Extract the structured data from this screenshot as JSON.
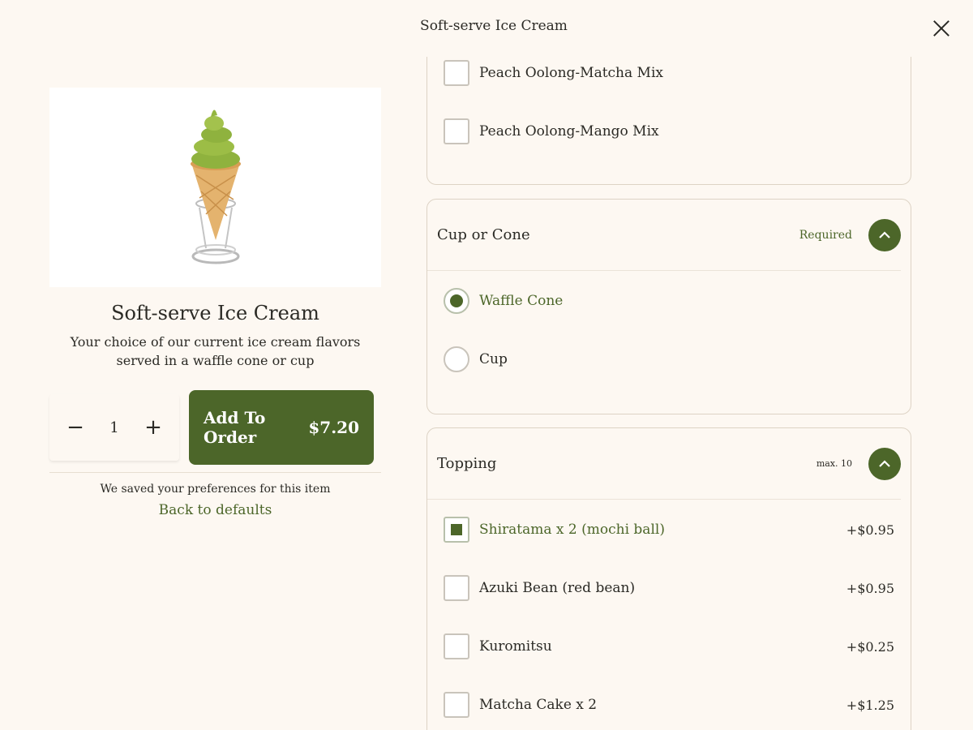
{
  "header": {
    "title": "Soft-serve Ice Cream"
  },
  "product": {
    "name": "Soft-serve Ice Cream",
    "description": "Your choice of our current ice cream flavors served in a waffle cone or cup"
  },
  "order": {
    "quantity": "1",
    "minus": "−",
    "plus": "+",
    "add_label": "Add To Order",
    "price": "$7.20"
  },
  "preferences": {
    "saved_text": "We saved your preferences for this item",
    "defaults_link": "Back to defaults"
  },
  "flavor_group": {
    "options": [
      {
        "label": "Peach Oolong-Matcha Mix",
        "checked": false
      },
      {
        "label": "Peach Oolong-Mango Mix",
        "checked": false
      }
    ]
  },
  "cup_group": {
    "title": "Cup or Cone",
    "badge": "Required",
    "options": [
      {
        "label": "Waffle Cone",
        "selected": true
      },
      {
        "label": "Cup",
        "selected": false
      }
    ]
  },
  "topping_group": {
    "title": "Topping",
    "badge": "max. 10",
    "options": [
      {
        "label": "Shiratama x 2 (mochi ball)",
        "price": "+$0.95",
        "checked": true
      },
      {
        "label": "Azuki Bean (red bean)",
        "price": "+$0.95",
        "checked": false
      },
      {
        "label": "Kuromitsu",
        "price": "+$0.25",
        "checked": false
      },
      {
        "label": "Matcha Cake x 2",
        "price": "+$1.25",
        "checked": false
      }
    ]
  },
  "colors": {
    "accent": "#4c6629",
    "background": "#fdf8f2"
  }
}
